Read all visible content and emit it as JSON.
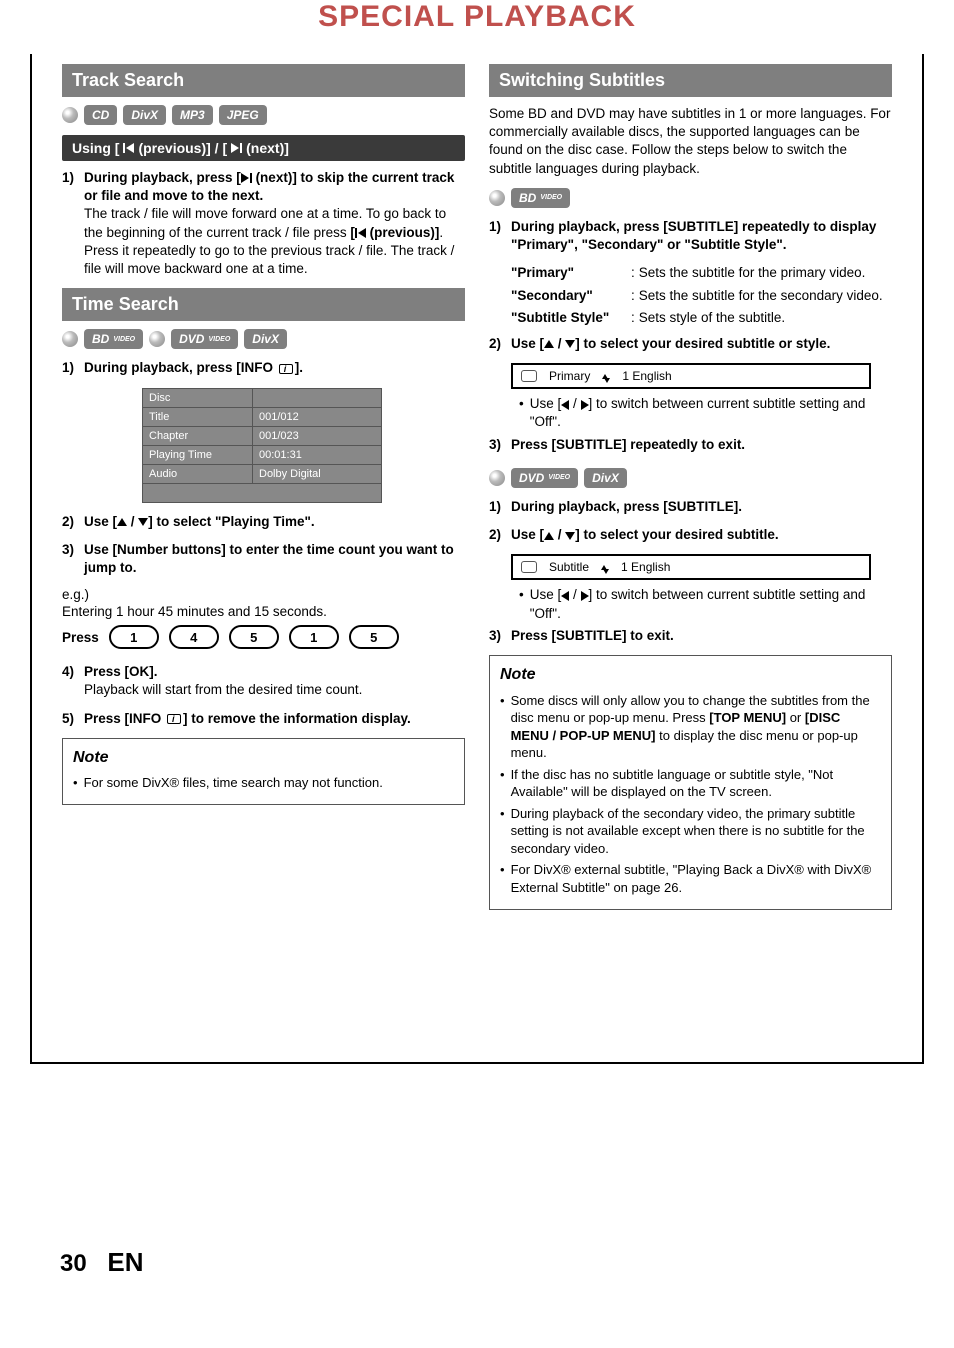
{
  "page": {
    "title": "SPECIAL PLAYBACK",
    "number": "30",
    "lang": "EN"
  },
  "left": {
    "section1": {
      "title": "Track Search",
      "badges": [
        "CD",
        "DivX",
        "MP3",
        "JPEG"
      ],
      "subbar_prefix": "Using [",
      "subbar_prev": " (previous)] / [",
      "subbar_next": " (next)]",
      "step1_lead_a": "During playback, press [",
      "step1_lead_b": " (next)] to skip the current track or file and move to the next.",
      "step1_body1": "The track / file will move forward one at a time. To go back to the beginning of the current track / file press ",
      "step1_prev_a": "[",
      "step1_prev_b": " (previous)]",
      "step1_body2": "Press it repeatedly to go to the previous track / file. The track / file will move backward one at a time."
    },
    "section2": {
      "title": "Time Search",
      "badges": [
        "BD VIDEO",
        "DVD VIDEO",
        "DivX"
      ],
      "step1_a": "During playback, press [INFO ",
      "step1_b": "].",
      "table": [
        [
          "Disc",
          ""
        ],
        [
          "Title",
          "001/012"
        ],
        [
          "Chapter",
          "001/023"
        ],
        [
          "Playing Time",
          "00:01:31"
        ],
        [
          "Audio",
          "Dolby Digital"
        ]
      ],
      "step2_a": "Use [",
      "step2_b": "] to select \"Playing Time\".",
      "step3": "Use [Number buttons] to enter the time count you want to jump to.",
      "eg1": "e.g.)",
      "eg2": "Entering 1 hour 45 minutes and 15 seconds.",
      "press_label": "Press",
      "press_buttons": [
        "1",
        "4",
        "5",
        "1",
        "5"
      ],
      "step4_lead": "Press [OK].",
      "step4_body": "Playback will start from the desired time count.",
      "step5_a": "Press [INFO ",
      "step5_b": "] to remove the information display.",
      "note_title": "Note",
      "note1": "For some DivX® files, time search may not function."
    }
  },
  "right": {
    "section1": {
      "title": "Switching Subtitles",
      "intro": "Some BD and DVD may have subtitles in 1 or more languages. For commercially available discs, the supported languages can be found on the disc case. Follow the steps below to switch the subtitle languages during playback.",
      "badges1": [
        "BD VIDEO"
      ],
      "bd_step1": "During playback, press [SUBTITLE] repeatedly to display \"Primary\", \"Secondary\" or \"Subtitle Style\".",
      "def_primary_t": "\"Primary\"",
      "def_primary_d": "Sets the subtitle for the primary video.",
      "def_secondary_t": "\"Secondary\"",
      "def_secondary_d": "Sets the subtitle for the secondary video.",
      "def_style_t": "\"Subtitle Style\"",
      "def_style_d": "Sets style of the subtitle.",
      "bd_step2_a": "Use [",
      "bd_step2_b": "] to select your desired subtitle or style.",
      "osd1_a": "Primary",
      "osd1_b": "1   English",
      "subbullet_a": "Use [",
      "subbullet_b": "] to switch between current subtitle setting and \"Off\".",
      "bd_step3": "Press [SUBTITLE] repeatedly to exit.",
      "badges2": [
        "DVD VIDEO",
        "DivX"
      ],
      "dvd_step1": "During playback, press [SUBTITLE].",
      "dvd_step2_a": "Use [",
      "dvd_step2_b": "] to select your desired subtitle.",
      "osd2_a": "Subtitle",
      "osd2_b": "1   English",
      "dvd_step3": "Press [SUBTITLE] to exit.",
      "note_title": "Note",
      "notes": [
        "Some discs will only allow you to change the subtitles from the disc menu or pop-up menu. Press [TOP MENU] or [DISC MENU / POP-UP MENU] to display the disc menu or pop-up menu.",
        "If the disc has no subtitle language or subtitle style, \"Not Available\" will be displayed on the TV screen.",
        "During playback of the secondary video, the primary subtitle setting is not available except when there is no subtitle for the secondary video.",
        "For DivX® external subtitle, \"Playing Back a DivX® with DivX® External Subtitle\" on page 26."
      ]
    }
  }
}
